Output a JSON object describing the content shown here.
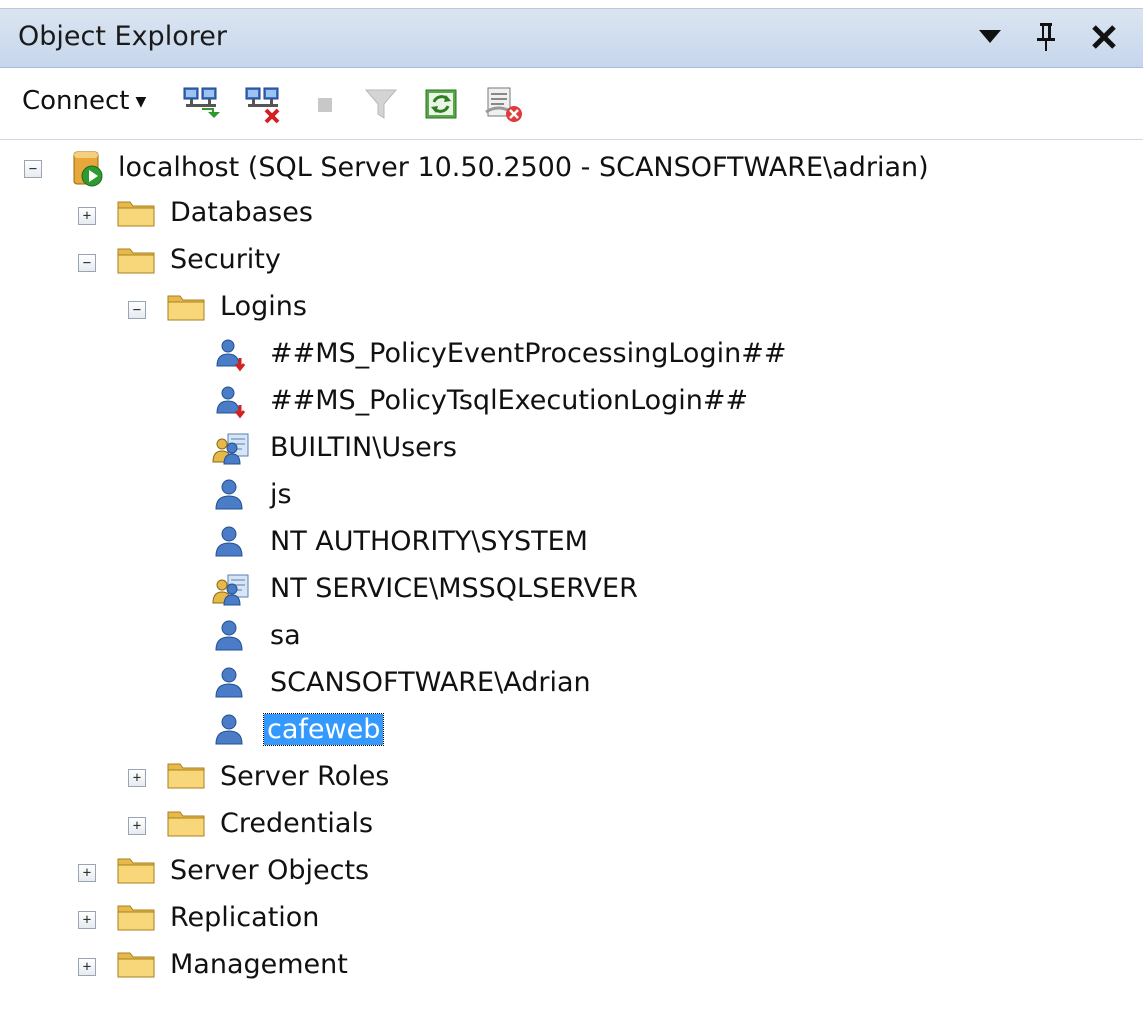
{
  "panel": {
    "title": "Object Explorer"
  },
  "toolbar": {
    "connect_label": "Connect"
  },
  "tree": {
    "server": "localhost (SQL Server 10.50.2500 - SCANSOFTWARE\\adrian)",
    "databases": "Databases",
    "security": "Security",
    "logins": "Logins",
    "login_items": [
      "##MS_PolicyEventProcessingLogin##",
      "##MS_PolicyTsqlExecutionLogin##",
      "BUILTIN\\Users",
      "js",
      "NT AUTHORITY\\SYSTEM",
      "NT SERVICE\\MSSQLSERVER",
      "sa",
      "SCANSOFTWARE\\Adrian",
      "cafeweb"
    ],
    "server_roles": "Server Roles",
    "credentials": "Credentials",
    "server_objects": "Server Objects",
    "replication": "Replication",
    "management": "Management",
    "selected": "cafeweb"
  }
}
